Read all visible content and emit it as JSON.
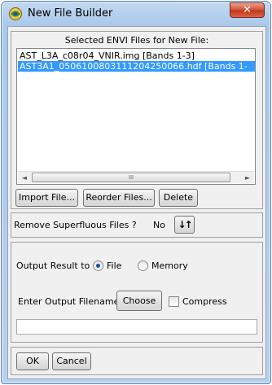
{
  "window": {
    "title": "New File Builder",
    "close_glyph": "✕"
  },
  "files": {
    "header": "Selected ENVI Files for New File:",
    "items": [
      {
        "label": "AST_L3A_c08r04_VNIR.img [Bands 1-3]",
        "selected": false
      },
      {
        "label": "AST3A1_0506100803111204250066.hdf [Bands 1-",
        "selected": true
      }
    ],
    "scroll_thumb_glyph": "III",
    "scroll_left_glyph": "◄",
    "scroll_right_glyph": "►",
    "buttons": {
      "import": "Import File...",
      "reorder": "Reorder Files...",
      "delete": "Delete"
    }
  },
  "superfluous": {
    "label": "Remove Superfluous Files ?",
    "value": "No",
    "toggle_icon": "↓↑"
  },
  "output": {
    "label": "Output Result to",
    "options": [
      {
        "label": "File",
        "checked": true
      },
      {
        "label": "Memory",
        "checked": false
      }
    ],
    "filename_label": "Enter Output Filename",
    "choose_label": "Choose",
    "compress_label": "Compress",
    "compress_checked": false,
    "filename_value": ""
  },
  "footer": {
    "ok_label": "OK",
    "cancel_label": "Cancel"
  }
}
